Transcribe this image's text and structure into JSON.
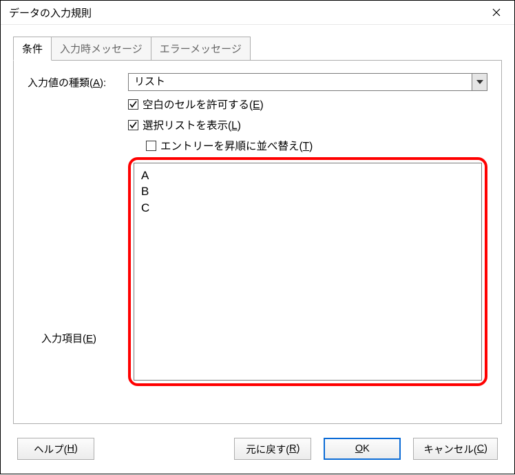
{
  "window": {
    "title": "データの入力規則"
  },
  "tabs": {
    "t0": "条件",
    "t1": "入力時メッセージ",
    "t2": "エラーメッセージ"
  },
  "form": {
    "type_label_pre": "入力値の種類(",
    "type_label_u": "A",
    "type_label_post": "):",
    "type_value": "リスト",
    "cb_blank_pre": "空白のセルを許可する(",
    "cb_blank_u": "E",
    "cb_blank_post": ")",
    "cb_showlist_pre": "選択リストを表示(",
    "cb_showlist_u": "L",
    "cb_showlist_post": ")",
    "cb_sort_pre": "エントリーを昇順に並べ替え(",
    "cb_sort_u": "T",
    "cb_sort_post": ")",
    "entries_label_pre": "入力項目(",
    "entries_label_u": "E",
    "entries_label_post": ")",
    "entries_value": "A\nB\nC"
  },
  "buttons": {
    "help_pre": "ヘルプ(",
    "help_u": "H",
    "help_post": ")",
    "reset_pre": "元に戻す(",
    "reset_u": "R",
    "reset_post": ")",
    "ok_u": "O",
    "ok_post": "K",
    "cancel_pre": "キャンセル(",
    "cancel_u": "C",
    "cancel_post": ")"
  }
}
